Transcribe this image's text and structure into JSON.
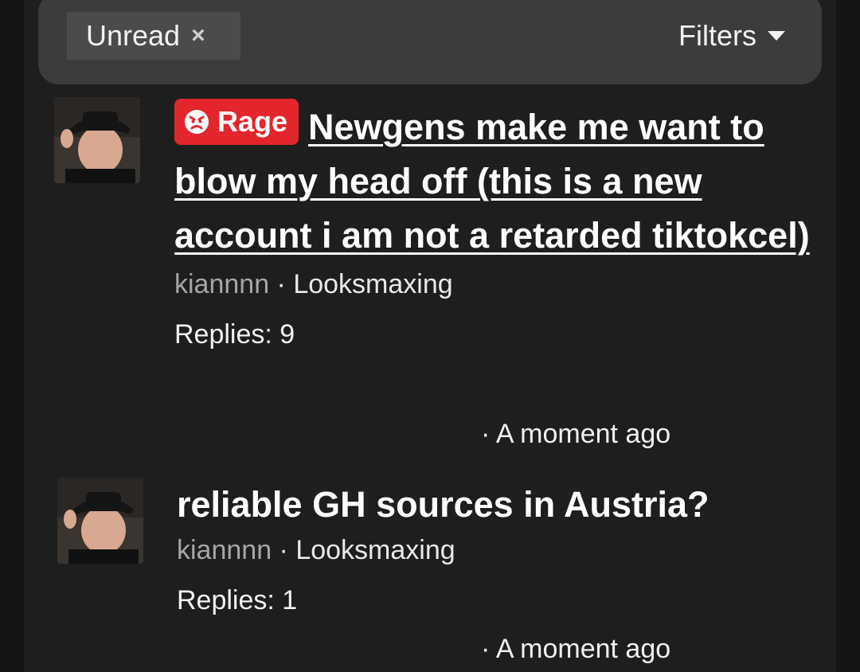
{
  "filter_bar": {
    "chip_label": "Unread",
    "chip_remove_icon": "×",
    "filters_label": "Filters"
  },
  "threads": [
    {
      "prefix": "Rage",
      "title": "Newgens make me want to blow my head off (this is a new account i am not a retarded tiktokcel)",
      "author": "kiannnn",
      "separator": " · ",
      "forum": "Looksmaxing",
      "replies": "Replies: 9",
      "time": "· A moment ago"
    },
    {
      "title": "reliable GH sources in Austria?",
      "author": "kiannnn",
      "separator": " · ",
      "forum": "Looksmaxing",
      "replies": "Replies: 1",
      "time": "· A moment ago"
    }
  ],
  "colors": {
    "background": "#1e1e1e",
    "filter_bar": "#3c3c3c",
    "rage_badge": "#e2262c",
    "author_text": "#a6a6a6"
  }
}
